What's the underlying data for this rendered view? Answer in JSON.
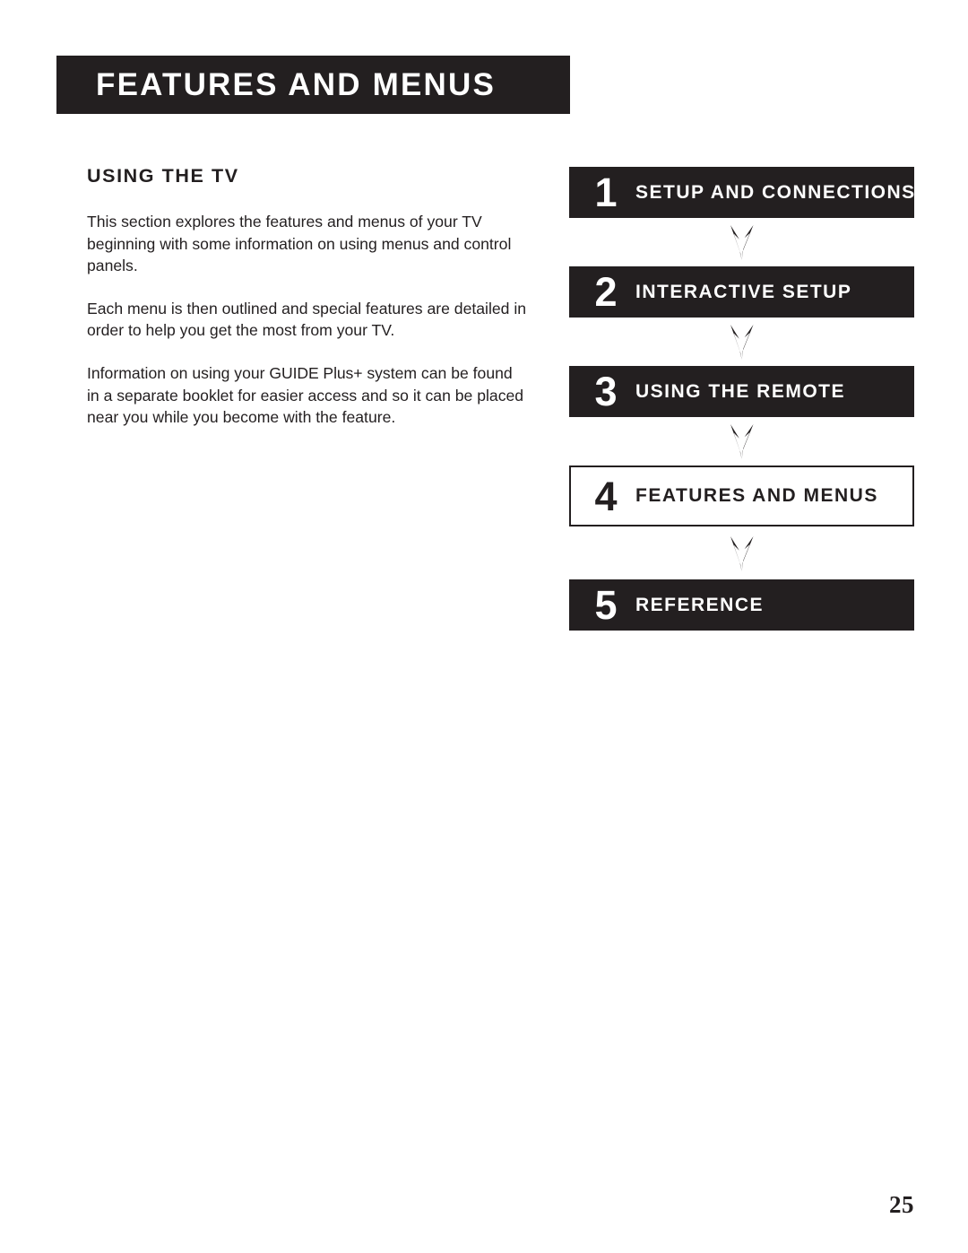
{
  "document": {
    "section_banner_title": "FEATURES AND MENUS",
    "page_number": "25",
    "background_color": "#ffffff",
    "ink_color": "#231f20"
  },
  "left_column": {
    "heading": "USING THE TV",
    "paragraphs": [
      "This section explores the features and menus of your TV beginning with some information on using menus and control panels.",
      "Each menu is then outlined and special features are detailed in order to help you get the most from your TV."
    ],
    "paragraph_3": {
      "before_brand": "Information on using your ",
      "brand": "GUIDE Plus+",
      "after_brand": " system can be found in a separate booklet for easier access and so it can be placed near you while you become with the feature."
    }
  },
  "flowchart": {
    "arrow_icon": "down-arrow-icon",
    "steps": [
      {
        "number": "1",
        "label": "SETUP AND CONNECTIONS",
        "style": "dark",
        "current": false
      },
      {
        "number": "2",
        "label": "INTERACTIVE SETUP",
        "style": "dark",
        "current": false
      },
      {
        "number": "3",
        "label": "USING THE REMOTE",
        "style": "dark",
        "current": false
      },
      {
        "number": "4",
        "label": "FEATURES AND MENUS",
        "style": "light",
        "current": true
      },
      {
        "number": "5",
        "label": "REFERENCE",
        "style": "dark",
        "current": false
      }
    ]
  }
}
